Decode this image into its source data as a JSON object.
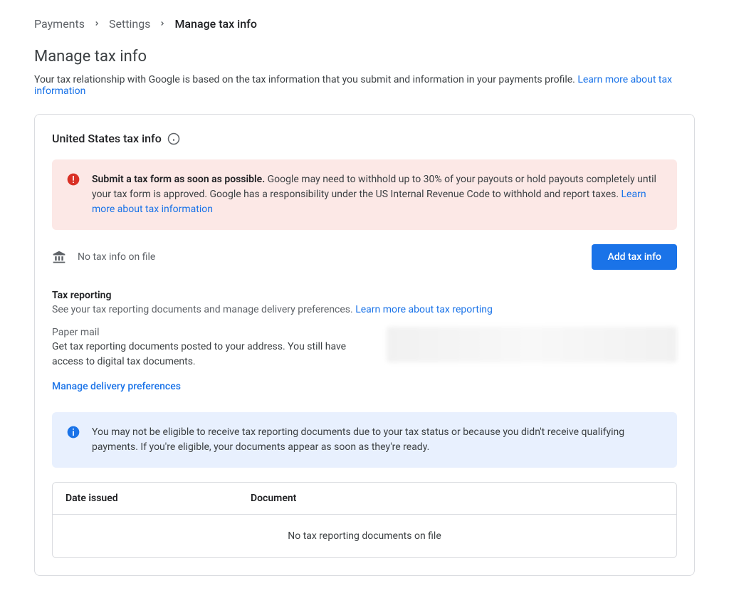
{
  "breadcrumb": {
    "items": [
      "Payments",
      "Settings"
    ],
    "current": "Manage tax info"
  },
  "page": {
    "title": "Manage tax info",
    "subtitle": "Your tax relationship with Google is based on the tax information that you submit and information in your payments profile. ",
    "subtitle_link": "Learn more about tax information"
  },
  "section": {
    "title": "United States tax info"
  },
  "alert_error": {
    "strong": "Submit a tax form as soon as possible.",
    "text": " Google may need to withhold up to 30% of your payouts or hold payouts completely until your tax form is approved. Google has a responsibility under the US Internal Revenue Code to withhold and report taxes. ",
    "link": "Learn more about tax information"
  },
  "tax_file": {
    "no_tax": "No tax info on file",
    "add_btn": "Add tax info"
  },
  "reporting": {
    "title": "Tax reporting",
    "desc": "See your tax reporting documents and manage delivery preferences. ",
    "desc_link": "Learn more about tax reporting",
    "delivery_label": "Paper mail",
    "delivery_desc": "Get tax reporting documents posted to your address. You still have access to digital tax documents.",
    "manage_link": "Manage delivery preferences"
  },
  "alert_info": {
    "text": "You may not be eligible to receive tax reporting documents due to your tax status or because you didn't receive qualifying payments. If you're eligible, your documents appear as soon as they're ready."
  },
  "table": {
    "col_date": "Date issued",
    "col_doc": "Document",
    "empty": "No tax reporting documents on file"
  }
}
